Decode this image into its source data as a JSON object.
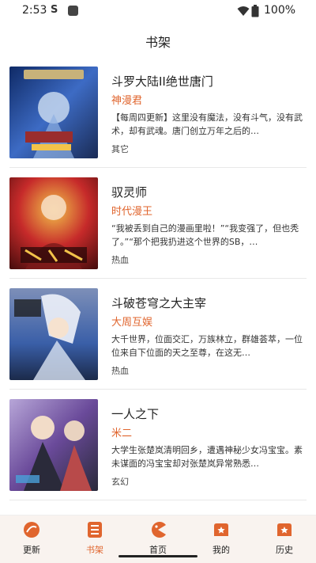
{
  "status": {
    "time": "2:53",
    "s_icon": "S",
    "battery": "100%"
  },
  "header": {
    "title": "书架"
  },
  "books": [
    {
      "title": "斗罗大陆II绝世唐门",
      "author": "神漫君",
      "desc": "【每周四更新】这里没有魔法，没有斗气，没有武术，却有武魂。唐门创立万年之后的…",
      "tag": "其它",
      "cover_colors": [
        "#1b3f8a",
        "#c7d8ef",
        "#9a2d2d"
      ]
    },
    {
      "title": "驭灵师",
      "author": "时代漫王",
      "desc": "“我被丢到自己的漫画里啦！”“我变强了，但也秃了。”“那个把我扔进这个世界的SB，…",
      "tag": "热血",
      "cover_colors": [
        "#c62a2a",
        "#f2c24a",
        "#5a1010"
      ]
    },
    {
      "title": "斗破苍穹之大主宰",
      "author": "大周互娱",
      "desc": "大千世界，位面交汇，万族林立，群雄荟萃，一位位来自下位面的天之至尊，在这无…",
      "tag": "热血",
      "cover_colors": [
        "#3a5fa8",
        "#d9e4f3",
        "#7d8fb8"
      ]
    },
    {
      "title": "一人之下",
      "author": "米二",
      "desc": "大学生张楚岚清明回乡，遭遇神秘少女冯宝宝。素未谋面的冯宝宝却对张楚岚异常熟悉…",
      "tag": "玄幻",
      "cover_colors": [
        "#6a4a9a",
        "#2a2a3a",
        "#b84a4a"
      ]
    }
  ],
  "nav": [
    {
      "label": "更新",
      "icon": "update-icon",
      "active": false
    },
    {
      "label": "书架",
      "icon": "bookshelf-icon",
      "active": true
    },
    {
      "label": "首页",
      "icon": "home-icon",
      "active": false
    },
    {
      "label": "我的",
      "icon": "profile-icon",
      "active": false
    },
    {
      "label": "历史",
      "icon": "history-icon",
      "active": false
    }
  ],
  "colors": {
    "accent": "#e0652e",
    "nav_bg": "#f9f3ef"
  }
}
